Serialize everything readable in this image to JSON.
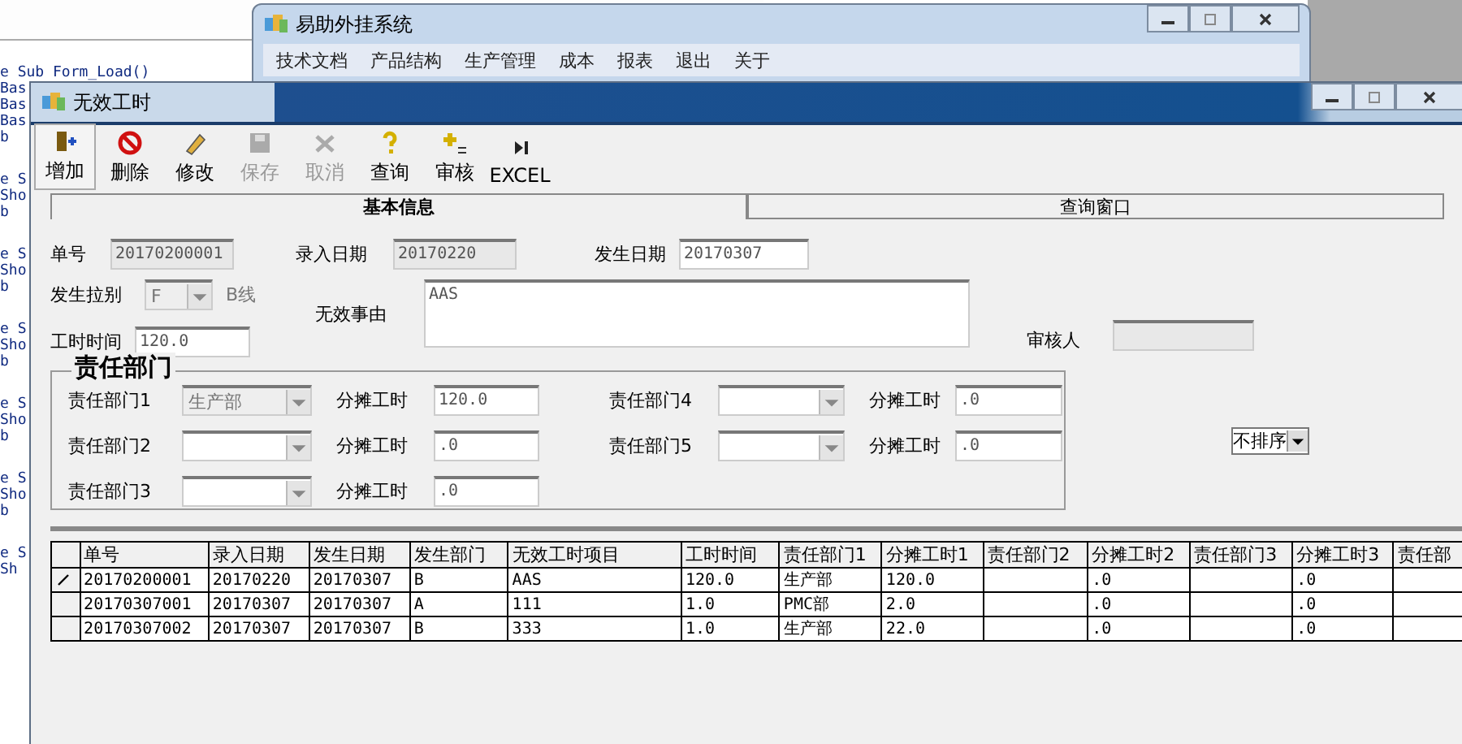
{
  "code_editor": {
    "blocks": [
      [
        "e Sub Form_Load()",
        "Bas",
        "Bas",
        "Bas",
        "b"
      ],
      [
        "e S",
        "Sho",
        "b"
      ],
      [
        "e S",
        "Sho",
        "b"
      ],
      [
        "e S",
        "Sho",
        "b"
      ],
      [
        "e S",
        "Sho",
        "b"
      ],
      [
        "e S",
        "Sho",
        "b"
      ],
      [
        "e S",
        "Sh"
      ]
    ]
  },
  "main_window": {
    "title": "易助外挂系统",
    "menu": [
      "技术文档",
      "产品结构",
      "生产管理",
      "成本",
      "报表",
      "退出",
      "关于"
    ]
  },
  "form_window": {
    "title": "无效工时",
    "toolbar": [
      {
        "label": "增加",
        "disabled": false
      },
      {
        "label": "删除",
        "disabled": false
      },
      {
        "label": "修改",
        "disabled": false
      },
      {
        "label": "保存",
        "disabled": true
      },
      {
        "label": "取消",
        "disabled": true
      },
      {
        "label": "查询",
        "disabled": false
      },
      {
        "label": "审核",
        "disabled": false
      },
      {
        "label": "EXCEL",
        "disabled": false
      }
    ],
    "tabs": [
      {
        "label": "基本信息",
        "selected": true
      },
      {
        "label": "查询窗口",
        "selected": false
      }
    ],
    "fields": {
      "order_no": {
        "label": "单号",
        "value": "20170200001"
      },
      "entry_date": {
        "label": "录入日期",
        "value": "20170220"
      },
      "occur_date": {
        "label": "发生日期",
        "value": "20170307"
      },
      "line": {
        "label": "发生拉别",
        "value": "F",
        "suffix": "B线"
      },
      "reason": {
        "label": "无效事由",
        "value": "AAS"
      },
      "hours": {
        "label": "工时时间",
        "value": "120.0"
      },
      "auditor": {
        "label": "审核人"
      }
    },
    "responsibility": {
      "title": "责任部门",
      "rows": [
        {
          "dept_label": "责任部门1",
          "dept": "生产部",
          "hours_label": "分摊工时",
          "hours": "120.0"
        },
        {
          "dept_label": "责任部门2",
          "hours_label": "分摊工时",
          "hours": ".0"
        },
        {
          "dept_label": "责任部门3",
          "hours_label": "分摊工时",
          "hours": ".0"
        },
        {
          "dept_label": "责任部门4",
          "hours_label": "分摊工时",
          "hours": ".0"
        },
        {
          "dept_label": "责任部门5",
          "hours_label": "分摊工时",
          "hours": ".0"
        }
      ]
    },
    "sort_combo": {
      "value": "不排序"
    },
    "table": {
      "columns": [
        "单号",
        "录入日期",
        "发生日期",
        "发生部门",
        "无效工时项目",
        "工时时间",
        "责任部门1",
        "分摊工时1",
        "责任部门2",
        "分摊工时2",
        "责任部门3",
        "分摊工时3",
        "责任部"
      ],
      "rows": [
        {
          "current": true,
          "cells": [
            "20170200001",
            "20170220",
            "20170307",
            "B",
            "AAS",
            "120.0",
            "生产部",
            "120.0",
            "",
            ".0",
            "",
            ".0",
            ""
          ]
        },
        {
          "current": false,
          "cells": [
            "20170307001",
            "20170307",
            "20170307",
            "A",
            "111",
            "1.0",
            "PMC部",
            "2.0",
            "",
            ".0",
            "",
            ".0",
            ""
          ]
        },
        {
          "current": false,
          "cells": [
            "20170307002",
            "20170307",
            "20170307",
            "B",
            "333",
            "1.0",
            "生产部",
            "22.0",
            "",
            ".0",
            "",
            ".0",
            ""
          ]
        }
      ]
    }
  }
}
